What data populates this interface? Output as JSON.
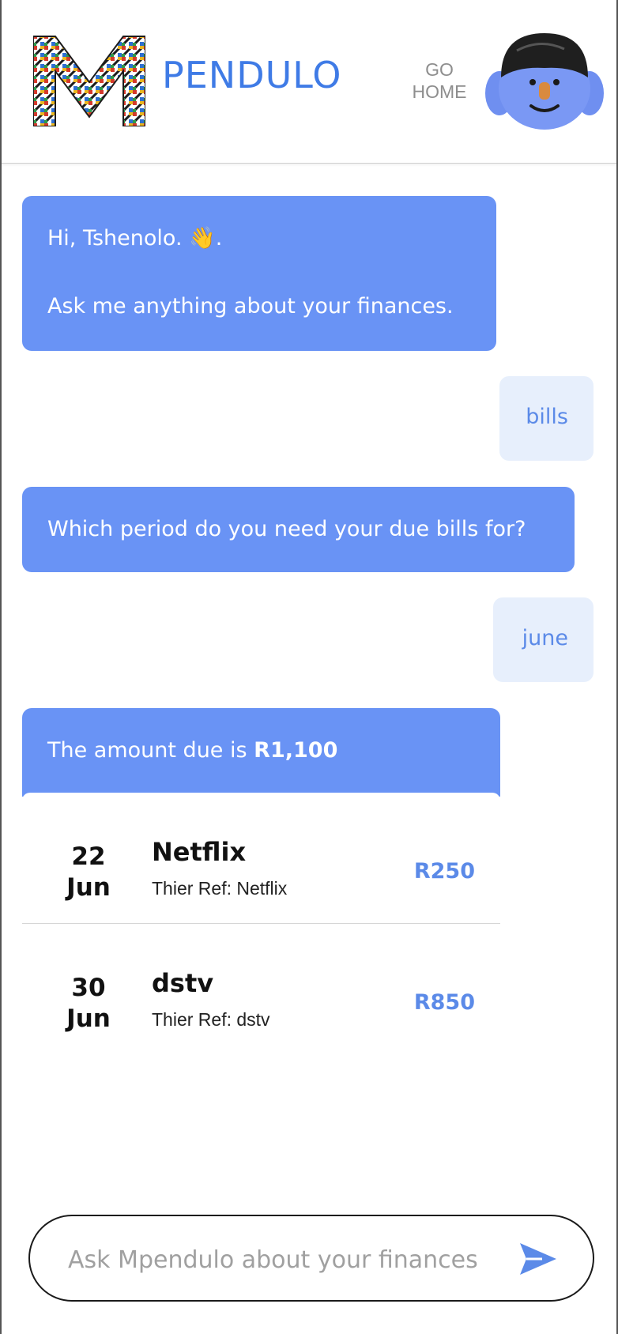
{
  "header": {
    "brand": "PENDULO",
    "go_home_line1": "GO",
    "go_home_line2": "HOME"
  },
  "chat": {
    "greeting_line1": "Hi, Tshenolo. 👋.",
    "greeting_line2": "Ask me anything about your finances.",
    "user_msg_1": "bills",
    "bot_question": "Which period do you need your due bills for?",
    "user_msg_2": "june",
    "amount_prefix": "The amount due is ",
    "amount_value": "R1,100"
  },
  "bills": [
    {
      "day": "22",
      "month": "Jun",
      "name": "Netflix",
      "ref": "Thier Ref: Netflix",
      "amount": "R250"
    },
    {
      "day": "30",
      "month": "Jun",
      "name": "dstv",
      "ref": "Thier Ref: dstv",
      "amount": "R850"
    }
  ],
  "composer": {
    "placeholder": "Ask Mpendulo about your finances"
  },
  "colors": {
    "accent": "#3f7be6",
    "bot_bubble": "#6993f5",
    "user_bubble": "#e7effc"
  }
}
